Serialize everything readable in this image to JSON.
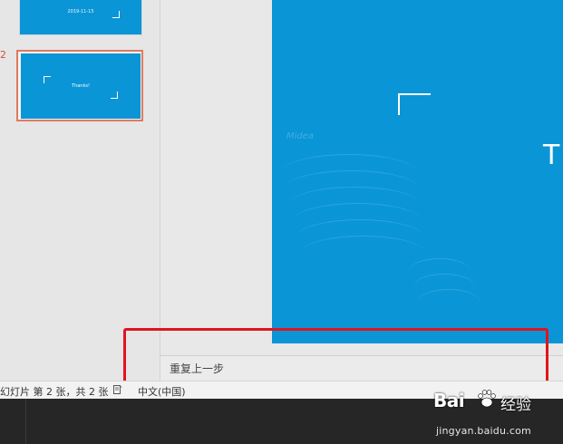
{
  "thumbnails": {
    "slide_number": "2",
    "slide1_date": "2019-11-15",
    "slide2_title": "Thanks!"
  },
  "canvas": {
    "title_letter": "T",
    "watermark": "Midea"
  },
  "notes": {
    "text": "重复上一步"
  },
  "status_bar": {
    "slide_info": "幻灯片 第 2 张，共 2 张",
    "notes_icon": "notes-icon",
    "language": "中文(中国)"
  },
  "brand": {
    "word": "Bai",
    "paw_icon": "paw-icon",
    "name": "经验",
    "url": "jingyan.baidu.com"
  },
  "colors": {
    "slide_blue": "#0a95d6",
    "selection": "#e07a5f",
    "highlight": "#e0141e",
    "taskbar": "#262626"
  }
}
